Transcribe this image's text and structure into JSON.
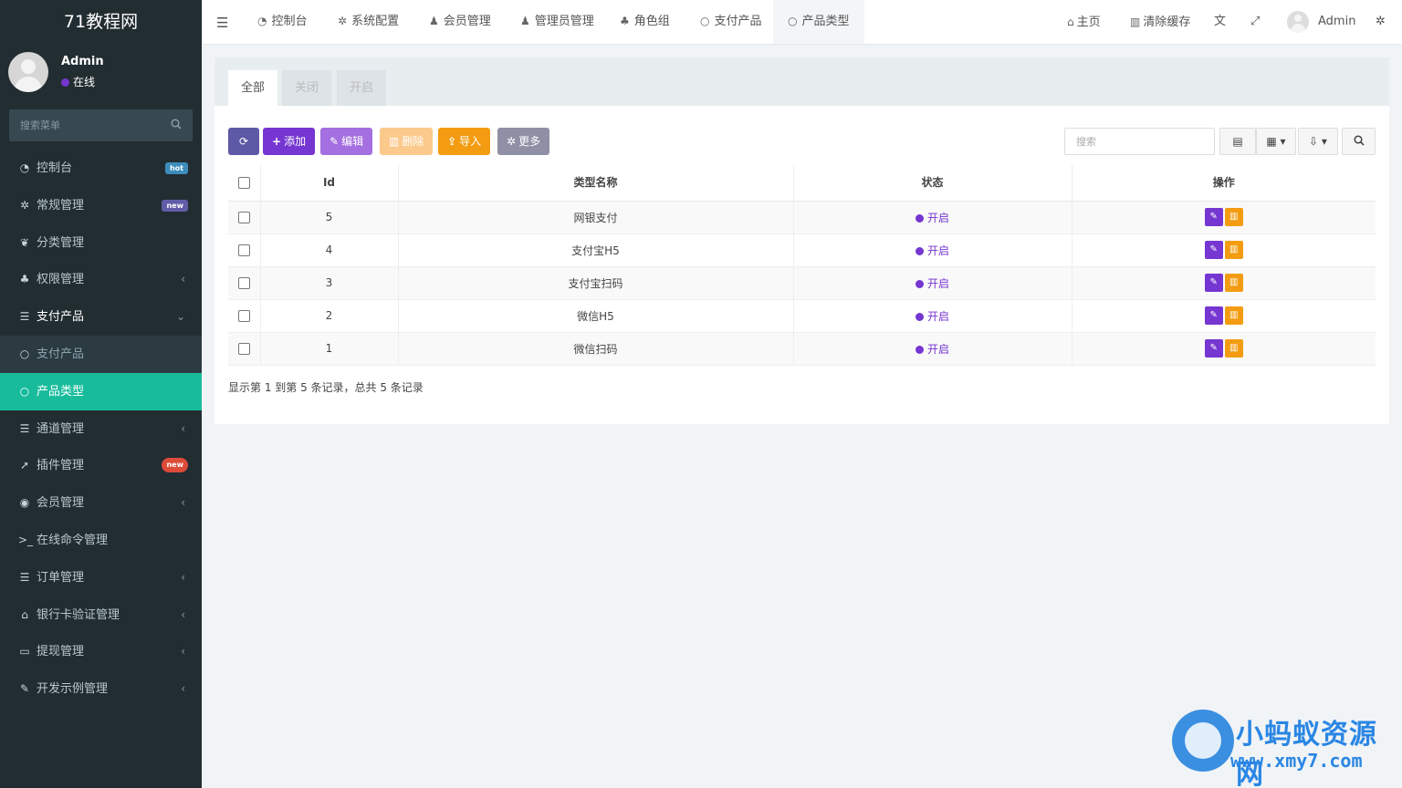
{
  "brand": "71教程网",
  "user": {
    "name": "Admin",
    "status": "在线"
  },
  "sidebar_search": {
    "placeholder": "搜索菜单"
  },
  "menu": [
    {
      "label": "控制台",
      "icon": "dashboard-icon",
      "glyph": "◔",
      "badge": "hot",
      "badge_color": "#3c8dbc"
    },
    {
      "label": "常规管理",
      "icon": "cogs-icon",
      "glyph": "✲",
      "badge": "new",
      "badge_color": "#605ca8"
    },
    {
      "label": "分类管理",
      "icon": "leaf-icon",
      "glyph": "❦"
    },
    {
      "label": "权限管理",
      "icon": "users-icon",
      "glyph": "♣",
      "chevron": "‹"
    },
    {
      "label": "支付产品",
      "icon": "list-icon",
      "glyph": "☰",
      "chevron": "⌄"
    },
    {
      "label": "支付产品",
      "icon": "circle-icon",
      "glyph": "○"
    },
    {
      "label": "产品类型",
      "icon": "circle-icon",
      "glyph": "○"
    },
    {
      "label": "通道管理",
      "icon": "list-icon",
      "glyph": "☰",
      "chevron": "‹"
    },
    {
      "label": "插件管理",
      "icon": "rocket-icon",
      "glyph": "➚",
      "badge": "new",
      "badge_color": "#dd4b39"
    },
    {
      "label": "会员管理",
      "icon": "user-circle-icon",
      "glyph": "◉",
      "chevron": "‹"
    },
    {
      "label": "在线命令管理",
      "icon": "terminal-icon",
      "glyph": ">_"
    },
    {
      "label": "订单管理",
      "icon": "list-icon",
      "glyph": "☰",
      "chevron": "‹"
    },
    {
      "label": "银行卡验证管理",
      "icon": "bank-icon",
      "glyph": "⌂",
      "chevron": "‹"
    },
    {
      "label": "提现管理",
      "icon": "card-icon",
      "glyph": "▭",
      "chevron": "‹"
    },
    {
      "label": "开发示例管理",
      "icon": "magic-icon",
      "glyph": "✎",
      "chevron": "‹"
    }
  ],
  "topnav": {
    "tabs": [
      {
        "label": "控制台",
        "icon": "dashboard-icon",
        "glyph": "◔"
      },
      {
        "label": "系统配置",
        "icon": "gear-icon",
        "glyph": "✲"
      },
      {
        "label": "会员管理",
        "icon": "user-icon",
        "glyph": "♟"
      },
      {
        "label": "管理员管理",
        "icon": "user-icon",
        "glyph": "♟"
      },
      {
        "label": "角色组",
        "icon": "users-icon",
        "glyph": "♣"
      },
      {
        "label": "支付产品",
        "icon": "circle-icon",
        "glyph": "○"
      },
      {
        "label": "产品类型",
        "icon": "circle-icon",
        "glyph": "○"
      }
    ],
    "home": "主页",
    "clear_cache": "清除缓存",
    "admin": "Admin"
  },
  "panel_tabs": [
    "全部",
    "关闭",
    "开启"
  ],
  "toolbar": {
    "add": "添加",
    "edit": "编辑",
    "delete": "删除",
    "import": "导入",
    "more": "更多"
  },
  "colors": {
    "primary": "#7536d1",
    "active_menu": "#18bc9c",
    "warning": "#f39c12",
    "refresh": "#5d59a6",
    "edit_btn": "#a46fe0",
    "delete_btn": "#fbc98c",
    "more_btn": "#8f8fa6"
  },
  "table_search_placeholder": "搜索",
  "table": {
    "headers": [
      "Id",
      "类型名称",
      "状态",
      "操作"
    ],
    "rows": [
      {
        "id": "5",
        "name": "网银支付",
        "status": "开启"
      },
      {
        "id": "4",
        "name": "支付宝H5",
        "status": "开启"
      },
      {
        "id": "3",
        "name": "支付宝扫码",
        "status": "开启"
      },
      {
        "id": "2",
        "name": "微信H5",
        "status": "开启"
      },
      {
        "id": "1",
        "name": "微信扫码",
        "status": "开启"
      }
    ]
  },
  "pagination_info": "显示第 1 到第 5 条记录，总共 5 条记录",
  "watermark": {
    "title": "小蚂蚁资源网",
    "url": "www.xmy7.com"
  }
}
